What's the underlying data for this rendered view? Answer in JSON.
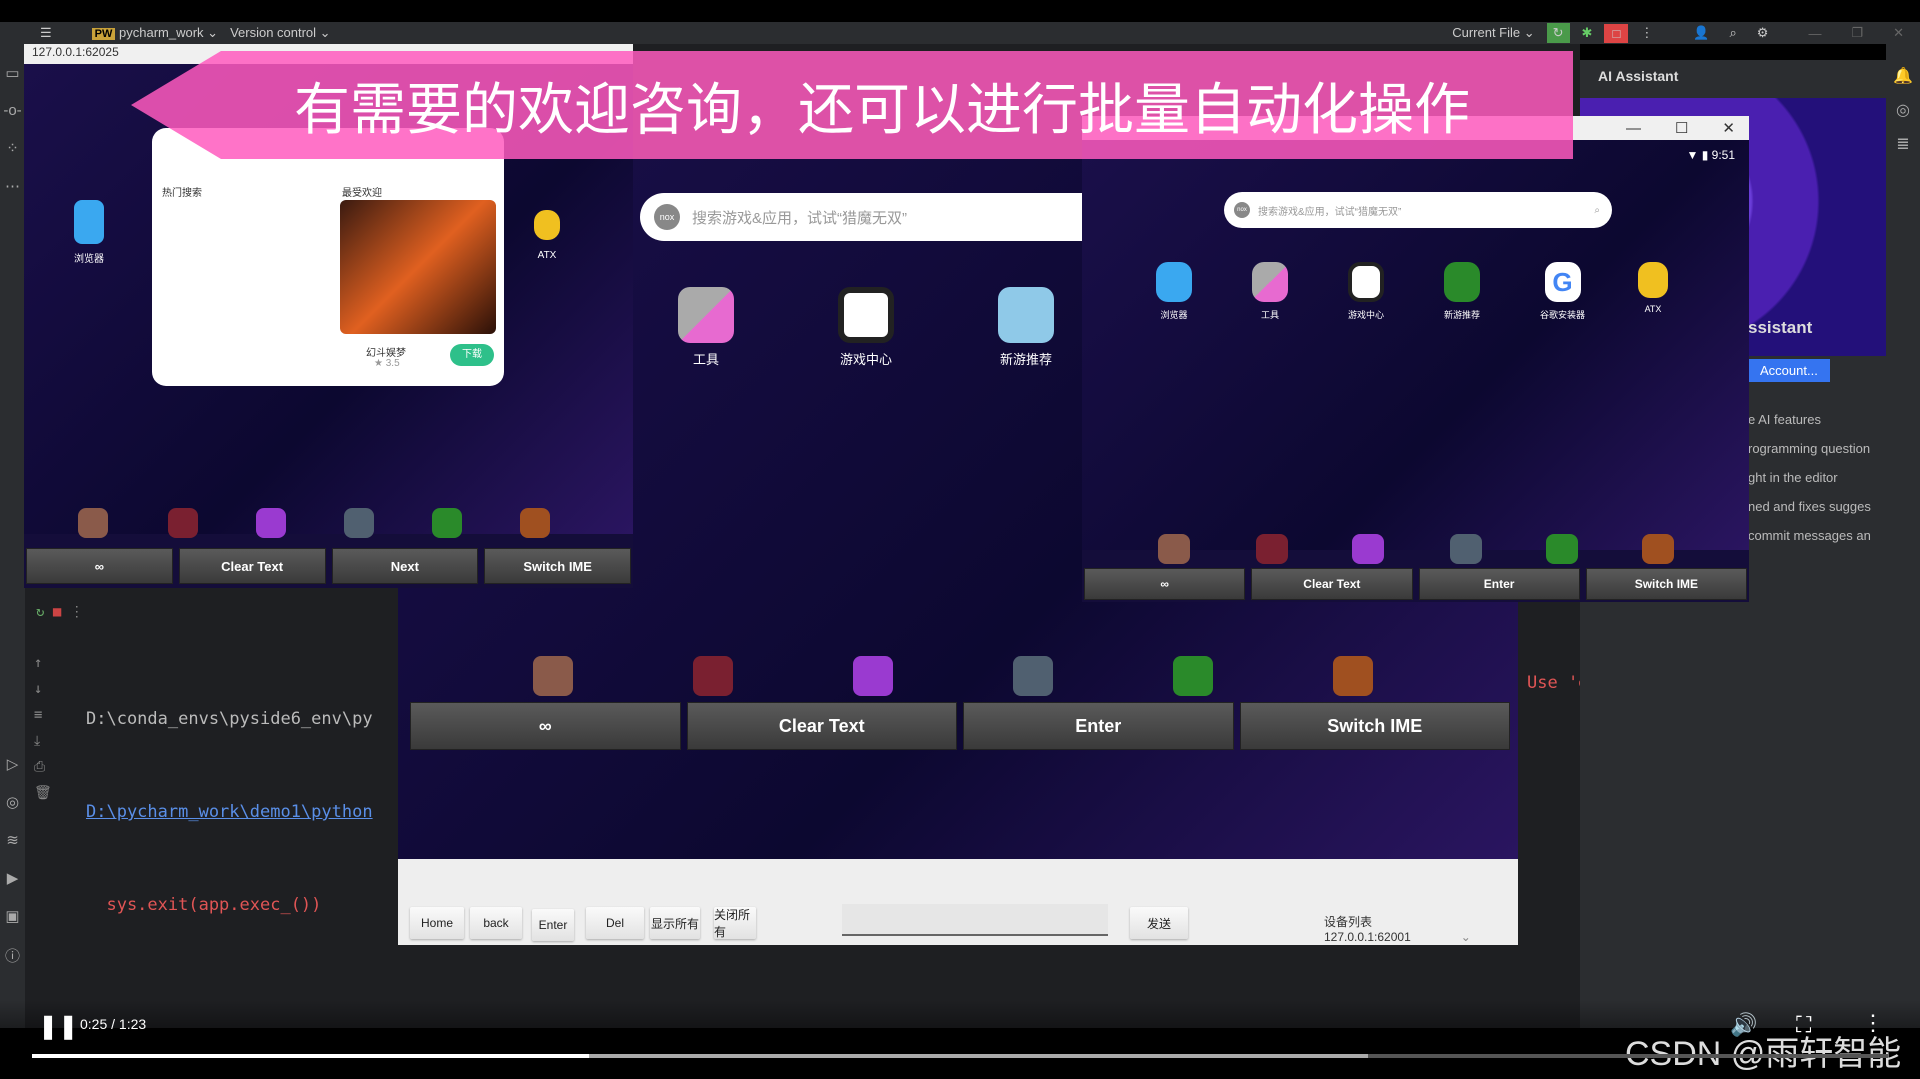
{
  "ide": {
    "project": "pycharm_work",
    "vcs": "Version control",
    "run_config": "Current File"
  },
  "ai_assistant": {
    "title": "AI Assistant",
    "heading": "ssistant",
    "button": "Account...",
    "lines": [
      "e AI features",
      "rogramming question",
      "ght in the editor",
      "ned and fixes sugges",
      "commit messages an"
    ]
  },
  "terminal": {
    "lines": [
      "D:\\conda_envs\\pyside6_env\\py",
      "D:\\pycharm_work\\demo1\\python",
      "  sys.exit(app.exec_())"
    ],
    "warning": "Use 'exec' instead."
  },
  "banner": {
    "text": "有需要的欢迎咨询，还可以进行批量自动化操作"
  },
  "window_left": {
    "title": "127.0.0.1:62025",
    "buttons": [
      "∞",
      "Clear Text",
      "Next",
      "Switch IME"
    ],
    "popup": {
      "hot": "热门搜索",
      "fav": "最受欢迎",
      "download": "下载",
      "game": "幻斗娱梦",
      "rating": "3.5"
    },
    "apps": [
      "浏览器",
      "ATX"
    ]
  },
  "window_mid": {
    "search_placeholder": "搜索游戏&应用，试试“猎魔无双”",
    "apps": [
      "工具",
      "游戏中心",
      "新游推荐"
    ],
    "buttons": [
      "∞",
      "Clear Text",
      "Enter",
      "Switch IME"
    ],
    "controls": {
      "home": "Home",
      "back": "back",
      "enter": "Enter",
      "del": "Del",
      "show_all": "显示所有",
      "close_all": "关闭所有",
      "input": "",
      "send": "发送",
      "device_label": "设备列表",
      "device": "127.0.0.1:62001"
    }
  },
  "window_right": {
    "time": "9:51",
    "search_placeholder": "搜索游戏&应用，试试“猎魔无双”",
    "apps": [
      "浏览器",
      "工具",
      "游戏中心",
      "新游推荐",
      "谷歌安装器",
      "ATX"
    ],
    "buttons": [
      "∞",
      "Clear Text",
      "Enter",
      "Switch IME"
    ]
  },
  "video": {
    "time": "0:25 / 1:23",
    "progress": 0.3,
    "buffered": 0.72,
    "watermark": "CSDN @雨轩智能"
  }
}
